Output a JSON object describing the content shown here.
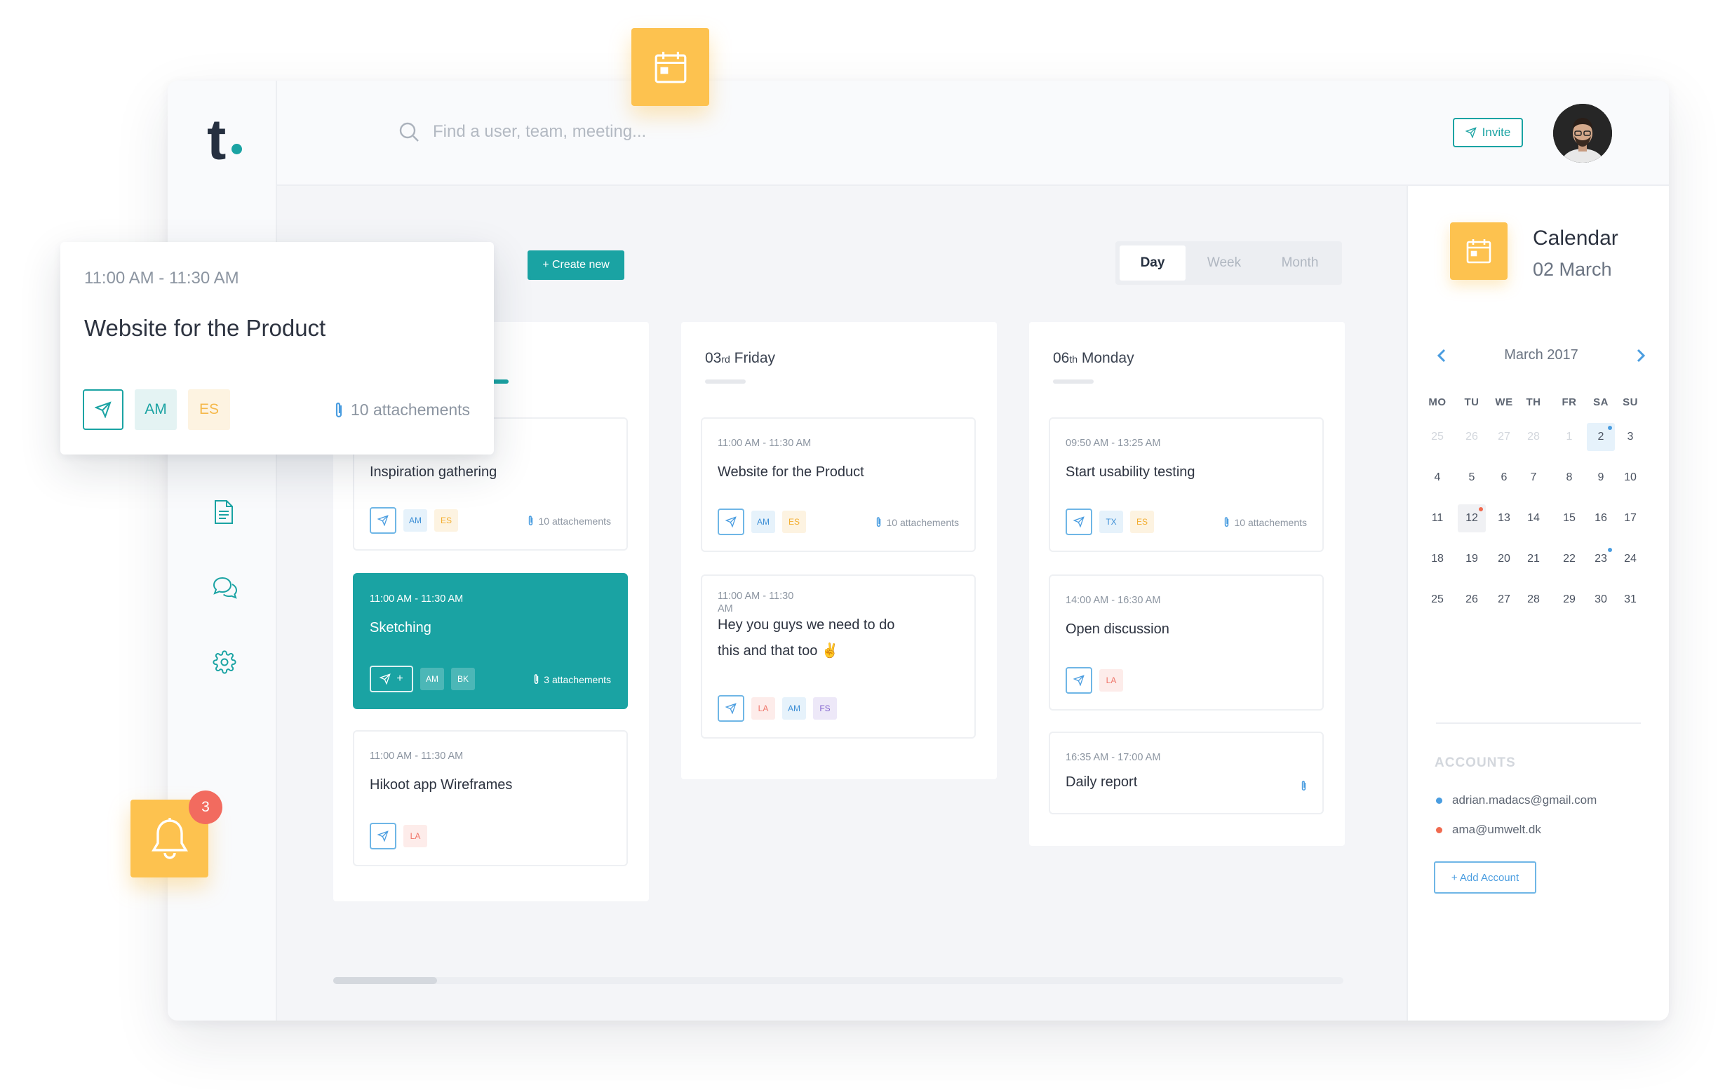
{
  "app": {
    "logo_text": "t"
  },
  "search": {
    "placeholder": "Find a user, team, meeting..."
  },
  "header": {
    "invite_label": "Invite",
    "avatar_name": "user-avatar"
  },
  "toolbar": {
    "create_label": "+ Create new"
  },
  "view_toggle": {
    "options": [
      "Day",
      "Week",
      "Month"
    ],
    "active": "Day"
  },
  "popup": {
    "time": "11:00 AM - 11:30 AM",
    "title": "Website for the Product",
    "tags": [
      "AM",
      "ES"
    ],
    "attachments": "10 attachements"
  },
  "columns": [
    {
      "cards": [
        {
          "title": "Inspiration gathering",
          "tags": [
            "AM",
            "ES"
          ],
          "attachments": "10 attachements"
        },
        {
          "time": "11:00 AM - 11:30 AM",
          "title": "Sketching",
          "send_label": "+",
          "tags": [
            "AM",
            "BK"
          ],
          "attachments": "3 attachements",
          "highlight": true
        },
        {
          "time": "11:00 AM - 11:30 AM",
          "title": "Hikoot app Wireframes",
          "tags": [
            "LA"
          ]
        }
      ]
    },
    {
      "day_num": "03",
      "day_suffix": "rd",
      "day_name": " Friday",
      "cards": [
        {
          "time": "11:00 AM - 11:30 AM",
          "title": "Website for the Product",
          "tags": [
            "AM",
            "ES"
          ],
          "attachments": "10 attachements"
        },
        {
          "time_line1": "11:00 AM - 11:30",
          "time_line2": "AM",
          "title_line1": "Hey you guys we need to do",
          "title_line2": "this and that too ✌",
          "tags": [
            "LA",
            "AM",
            "FS"
          ]
        }
      ]
    },
    {
      "day_num": "06",
      "day_suffix": "th",
      "day_name": " Monday",
      "cards": [
        {
          "time": "09:50 AM - 13:25 AM",
          "title": "Start usability testing",
          "tags": [
            "TX",
            "ES"
          ],
          "attachments": "10 attachements"
        },
        {
          "time": "14:00 AM - 16:30 AM",
          "title": "Open discussion",
          "tags": [
            "LA"
          ]
        },
        {
          "time": "16:35 AM - 17:00 AM",
          "title": "Daily report"
        }
      ]
    }
  ],
  "calendar": {
    "title": "Calendar",
    "date": "02 March",
    "month_label": "March 2017",
    "weekdays": [
      "MO",
      "TU",
      "WE",
      "TH",
      "FR",
      "SA",
      "SU"
    ],
    "weeks": [
      [
        "25",
        "26",
        "27",
        "28",
        "1",
        "2",
        "3"
      ],
      [
        "4",
        "5",
        "6",
        "7",
        "8",
        "9",
        "10"
      ],
      [
        "11",
        "12",
        "13",
        "14",
        "15",
        "16",
        "17"
      ],
      [
        "18",
        "19",
        "20",
        "21",
        "22",
        "23",
        "24"
      ],
      [
        "25",
        "26",
        "27",
        "28",
        "29",
        "30",
        "31"
      ]
    ],
    "selected_day": "2",
    "today_day": "12"
  },
  "accounts": {
    "heading": "ACCOUNTS",
    "items": [
      {
        "email": "adrian.madacs@gmail.com",
        "color": "#4a9de0"
      },
      {
        "email": "ama@umwelt.dk",
        "color": "#f06a4f"
      }
    ],
    "add_label": "+ Add Account"
  },
  "notifications": {
    "count": "3"
  },
  "colors": {
    "teal": "#1aa3a3",
    "yellow": "#fdc24f",
    "blue": "#4a9de0",
    "red": "#f26b5f"
  }
}
